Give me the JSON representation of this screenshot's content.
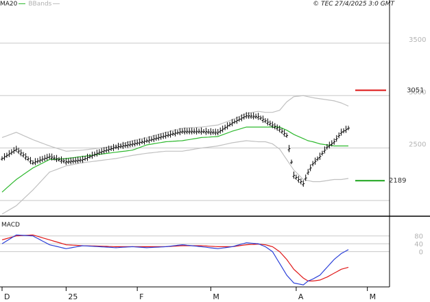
{
  "legend": {
    "ma_label": "MA20",
    "bb_label": "BBands",
    "ma_color": "#2db82d",
    "bb_color": "#c0c0c0"
  },
  "copyright": "© TEC 27/4/2025 3:0 GMT",
  "colors": {
    "price_bars": "#000000",
    "macd_line": "#2a3fd8",
    "signal_line": "#e01818",
    "resistance": "#dd1111",
    "support": "#19a319",
    "grid": "#c8c8c8"
  },
  "chart_data": {
    "type": "line",
    "title": "",
    "xlabel": "",
    "ylabel": "",
    "x_axis": {
      "labels": [
        "D",
        "25",
        "F",
        "M",
        "A",
        "M"
      ],
      "n_sessions": 146,
      "tick_sessions": [
        0,
        27,
        57,
        88,
        124,
        154
      ]
    },
    "price_panel": {
      "y_ticks": [
        3500,
        3000,
        2500
      ],
      "y_tick_labels": [
        "3500",
        "3000",
        "2500"
      ],
      "ylim": [
        1850,
        3820
      ],
      "sample_points": {
        "session": [
          0,
          6,
          13,
          20,
          27,
          34,
          41,
          48,
          55,
          61,
          69,
          76,
          84,
          91,
          97,
          103,
          108,
          111,
          114,
          117,
          120,
          123,
          127,
          129,
          131,
          134,
          137,
          140,
          143,
          146
        ],
        "price": [
          2400,
          2490,
          2360,
          2420,
          2370,
          2390,
          2460,
          2510,
          2540,
          2570,
          2620,
          2660,
          2660,
          2650,
          2740,
          2810,
          2800,
          2760,
          2720,
          2680,
          2620,
          2240,
          2160,
          2270,
          2350,
          2420,
          2510,
          2560,
          2650,
          2690
        ]
      },
      "ma20": {
        "session": [
          0,
          6,
          13,
          20,
          27,
          34,
          41,
          48,
          55,
          61,
          69,
          76,
          84,
          91,
          97,
          103,
          108,
          111,
          114,
          117,
          120,
          123,
          127,
          129,
          131,
          134,
          137,
          140,
          143,
          146
        ],
        "value": [
          2080,
          2200,
          2310,
          2390,
          2400,
          2420,
          2440,
          2460,
          2480,
          2530,
          2560,
          2570,
          2600,
          2610,
          2660,
          2700,
          2700,
          2700,
          2700,
          2700,
          2670,
          2630,
          2590,
          2570,
          2560,
          2540,
          2530,
          2520,
          2520,
          2520
        ]
      },
      "bb_upper": {
        "session": [
          0,
          6,
          13,
          20,
          27,
          34,
          41,
          48,
          55,
          61,
          69,
          76,
          84,
          91,
          97,
          103,
          108,
          111,
          114,
          117,
          120,
          123,
          127,
          129,
          131,
          134,
          137,
          140,
          143,
          146
        ],
        "value": [
          2600,
          2650,
          2580,
          2520,
          2470,
          2480,
          2500,
          2520,
          2570,
          2600,
          2650,
          2690,
          2700,
          2720,
          2770,
          2830,
          2850,
          2840,
          2840,
          2860,
          2940,
          2990,
          3000,
          2990,
          2980,
          2970,
          2960,
          2950,
          2930,
          2900
        ]
      },
      "bb_lower": {
        "session": [
          0,
          6,
          13,
          20,
          27,
          34,
          41,
          48,
          55,
          61,
          69,
          76,
          84,
          91,
          97,
          103,
          108,
          111,
          114,
          117,
          120,
          123,
          127,
          129,
          131,
          134,
          137,
          140,
          143,
          146
        ],
        "value": [
          1870,
          1950,
          2100,
          2270,
          2330,
          2360,
          2380,
          2400,
          2430,
          2450,
          2470,
          2470,
          2500,
          2520,
          2550,
          2570,
          2560,
          2560,
          2540,
          2490,
          2390,
          2290,
          2200,
          2190,
          2180,
          2180,
          2190,
          2200,
          2200,
          2210
        ]
      },
      "resistance": {
        "value": 3051,
        "label": "3051"
      },
      "support": {
        "value": 2189,
        "label": "2189"
      }
    },
    "macd_panel": {
      "title": "MACD",
      "y_ticks": [
        80,
        40,
        0
      ],
      "y_tick_labels": [
        "80",
        "40",
        "0"
      ],
      "ylim": [
        -180,
        170
      ],
      "macd": {
        "session": [
          0,
          6,
          13,
          20,
          27,
          34,
          41,
          48,
          55,
          61,
          69,
          76,
          84,
          91,
          97,
          103,
          108,
          111,
          114,
          117,
          120,
          123,
          127,
          129,
          131,
          134,
          137,
          140,
          143,
          146
        ],
        "value": [
          40,
          85,
          80,
          35,
          15,
          30,
          25,
          20,
          25,
          20,
          25,
          35,
          25,
          15,
          25,
          45,
          40,
          25,
          0,
          -60,
          -120,
          -160,
          -170,
          -150,
          -140,
          -120,
          -80,
          -40,
          -10,
          10
        ]
      },
      "signal": {
        "session": [
          0,
          6,
          13,
          20,
          27,
          34,
          41,
          48,
          55,
          61,
          69,
          76,
          84,
          91,
          97,
          103,
          108,
          111,
          114,
          117,
          120,
          123,
          127,
          129,
          131,
          134,
          137,
          140,
          143,
          146
        ],
        "value": [
          60,
          80,
          85,
          60,
          35,
          30,
          28,
          25,
          25,
          25,
          25,
          30,
          30,
          25,
          25,
          35,
          38,
          35,
          25,
          0,
          -40,
          -90,
          -135,
          -150,
          -150,
          -145,
          -130,
          -110,
          -90,
          -80
        ]
      }
    }
  }
}
